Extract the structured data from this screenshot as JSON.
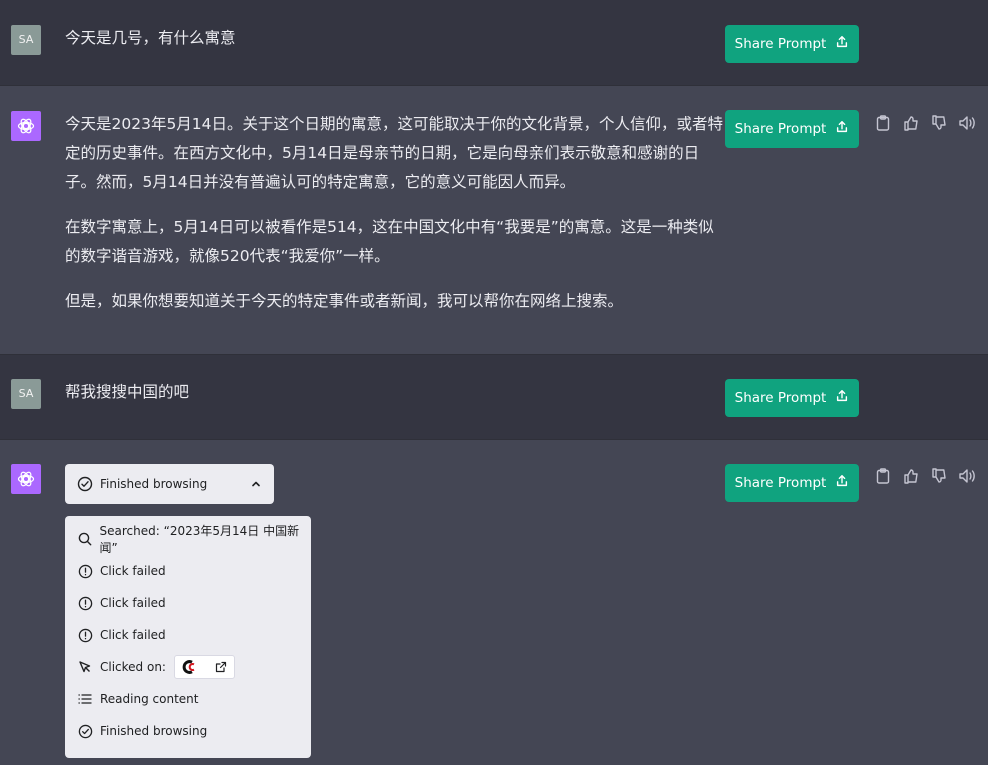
{
  "colors": {
    "user_row": "#343541",
    "assistant_row": "#444654",
    "accent": "#10a37f",
    "gpt_avatar": "#ab68ff",
    "user_avatar": "#8a9a97"
  },
  "share_label": "Share Prompt",
  "messages": {
    "m1": {
      "avatar": "SA",
      "text": "今天是几号，有什么寓意"
    },
    "m2": {
      "p1": "今天是2023年5月14日。关于这个日期的寓意，这可能取决于你的文化背景，个人信仰，或者特定的历史事件。在西方文化中，5月14日是母亲节的日期，它是向母亲们表示敬意和感谢的日子。然而，5月14日并没有普遍认可的特定寓意，它的意义可能因人而异。",
      "p2": "在数字寓意上，5月14日可以被看作是514，这在中国文化中有“我要是”的寓意。这是一种类似的数字谐音游戏，就像520代表“我爱你”一样。",
      "p3": "但是，如果你想要知道关于今天的特定事件或者新闻，我可以帮你在网络上搜索。"
    },
    "m3": {
      "avatar": "SA",
      "text": "帮我搜搜中国的吧"
    },
    "m4": {
      "browse_header": "Finished browsing",
      "steps": {
        "s0": "Searched: “2023年5月14日 中国新闻”",
        "s1": "Click failed",
        "s2": "Click failed",
        "s3": "Click failed",
        "s4": "Clicked on:",
        "s5": "Reading content",
        "s6": "Finished browsing"
      }
    }
  },
  "icons": [
    "openai-logo-icon",
    "share-icon",
    "clipboard-icon",
    "thumbs-up-icon",
    "thumbs-down-icon",
    "speaker-icon",
    "chevron-up-icon",
    "check-circle-icon",
    "search-icon",
    "alert-circle-icon",
    "cursor-icon",
    "list-icon",
    "site-logo-icon",
    "external-link-icon"
  ]
}
